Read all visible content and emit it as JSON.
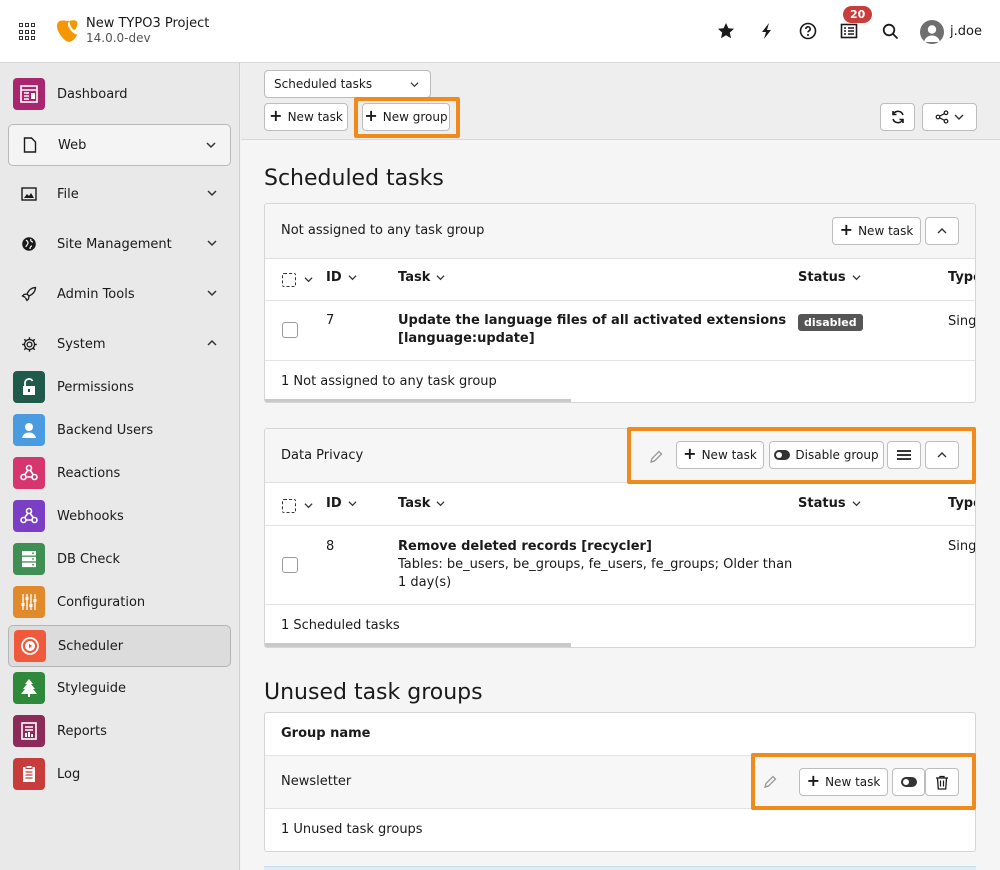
{
  "header": {
    "project_name": "New TYPO3 Project",
    "project_version": "14.0.0-dev",
    "notification_count": "20",
    "username": "j.doe"
  },
  "sidebar": {
    "items": [
      {
        "label": "Dashboard",
        "icon": "dashboard-icon",
        "color": "#a8266f"
      },
      {
        "label": "Web",
        "icon": "page-icon"
      },
      {
        "label": "File",
        "icon": "image-icon"
      },
      {
        "label": "Site Management",
        "icon": "globe-icon"
      },
      {
        "label": "Admin Tools",
        "icon": "rocket-icon"
      },
      {
        "label": "System",
        "icon": "gear-icon"
      },
      {
        "label": "Permissions",
        "icon": "lock-icon",
        "color": "#1f5a4a"
      },
      {
        "label": "Backend Users",
        "icon": "user-icon",
        "color": "#4a9be0"
      },
      {
        "label": "Reactions",
        "icon": "webhook-icon",
        "color": "#d6356d"
      },
      {
        "label": "Webhooks",
        "icon": "webhook-icon",
        "color": "#7b3fc6"
      },
      {
        "label": "DB Check",
        "icon": "database-icon",
        "color": "#3f8f55"
      },
      {
        "label": "Configuration",
        "icon": "sliders-icon",
        "color": "#e08a2c"
      },
      {
        "label": "Scheduler",
        "icon": "scheduler-icon",
        "color": "#f05a3c"
      },
      {
        "label": "Styleguide",
        "icon": "tree-icon",
        "color": "#2e8a3a"
      },
      {
        "label": "Reports",
        "icon": "report-icon",
        "color": "#8c2a5a"
      },
      {
        "label": "Log",
        "icon": "log-icon",
        "color": "#c83c3c"
      }
    ]
  },
  "toolbar": {
    "select_value": "Scheduled tasks",
    "new_task_label": "New task",
    "new_group_label": "New group"
  },
  "main": {
    "title": "Scheduled tasks",
    "columns": {
      "id": "ID",
      "task": "Task",
      "status": "Status",
      "type": "Type"
    },
    "groups": [
      {
        "title": "Not assigned to any task group",
        "new_task_label": "New task",
        "rows": [
          {
            "id": "7",
            "task_line1": "Update the language files of all activated extensions",
            "task_line2": "[language:update]",
            "status": "disabled",
            "type": "Sing"
          }
        ],
        "footer": "1 Not assigned to any task group"
      },
      {
        "title": "Data Privacy",
        "new_task_label": "New task",
        "disable_label": "Disable group",
        "rows": [
          {
            "id": "8",
            "task_line1": "Remove deleted records [recycler]",
            "detail_line1": "Tables: be_users, be_groups, fe_users, fe_groups; Older than",
            "detail_line2": "1 day(s)",
            "type": "Sing"
          }
        ],
        "footer": "1 Scheduled tasks"
      }
    ],
    "unused": {
      "title": "Unused task groups",
      "column": "Group name",
      "rows": [
        {
          "name": "Newsletter",
          "new_task_label": "New task"
        }
      ],
      "footer": "1 Unused task groups"
    }
  },
  "colors": {
    "highlight": "#f08a1c",
    "badge": "#c83c3c"
  }
}
